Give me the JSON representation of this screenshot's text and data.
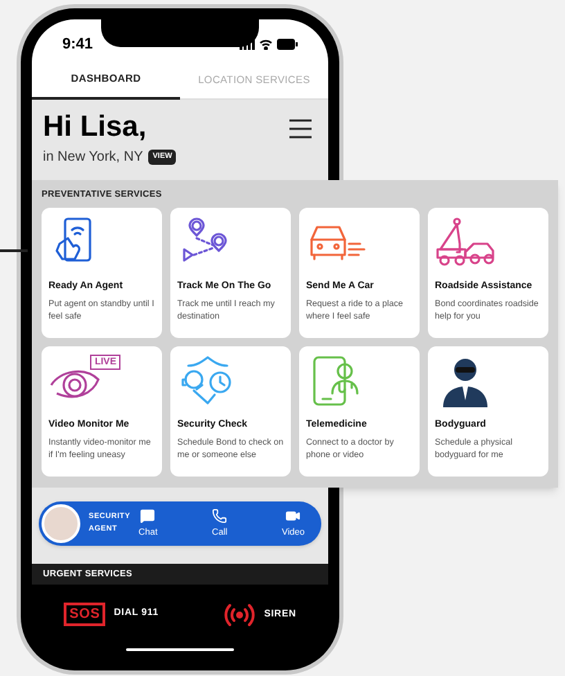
{
  "status_bar": {
    "time": "9:41"
  },
  "tabs": [
    {
      "label": "DASHBOARD",
      "selected": true
    },
    {
      "label": "LOCATION SERVICES",
      "selected": false
    }
  ],
  "greeting": {
    "title": "Hi Lisa,",
    "location": "in New York, NY",
    "view_button": "VIEW"
  },
  "preventative_services": {
    "heading": "PREVENTATIVE SERVICES",
    "cards": [
      {
        "kind": "agent",
        "title": "Ready An Agent",
        "description": "Put agent on standby until I feel safe"
      },
      {
        "kind": "track",
        "title": "Track Me On The Go",
        "description": "Track me until I reach my destination"
      },
      {
        "kind": "car",
        "title": "Send Me A Car",
        "description": "Request a ride to a place where I feel safe"
      },
      {
        "kind": "tow",
        "title": "Roadside Assistance",
        "description": "Bond coordinates roadside help for you"
      },
      {
        "kind": "video",
        "title": "Video Monitor Me",
        "description": "Instantly video-monitor me if I'm feeling uneasy",
        "badge": "LIVE"
      },
      {
        "kind": "check",
        "title": "Security Check",
        "description": "Schedule Bond to check on me or someone else"
      },
      {
        "kind": "doctor",
        "title": "Telemedicine",
        "description": "Connect to a doctor by phone or video"
      },
      {
        "kind": "guard",
        "title": "Bodyguard",
        "description": "Schedule a physical bodyguard for me"
      }
    ]
  },
  "agent_bar": {
    "label_lines": [
      "SECURITY",
      "AGENT"
    ],
    "actions": [
      {
        "kind": "chat",
        "label": "Chat"
      },
      {
        "kind": "call",
        "label": "Call"
      },
      {
        "kind": "video",
        "label": "Video"
      }
    ]
  },
  "urgent_services": {
    "heading": "URGENT SERVICES",
    "actions": [
      {
        "kind": "sos",
        "badge": "SOS",
        "label": "DIAL 911"
      },
      {
        "kind": "siren",
        "label": "SIREN"
      }
    ]
  }
}
